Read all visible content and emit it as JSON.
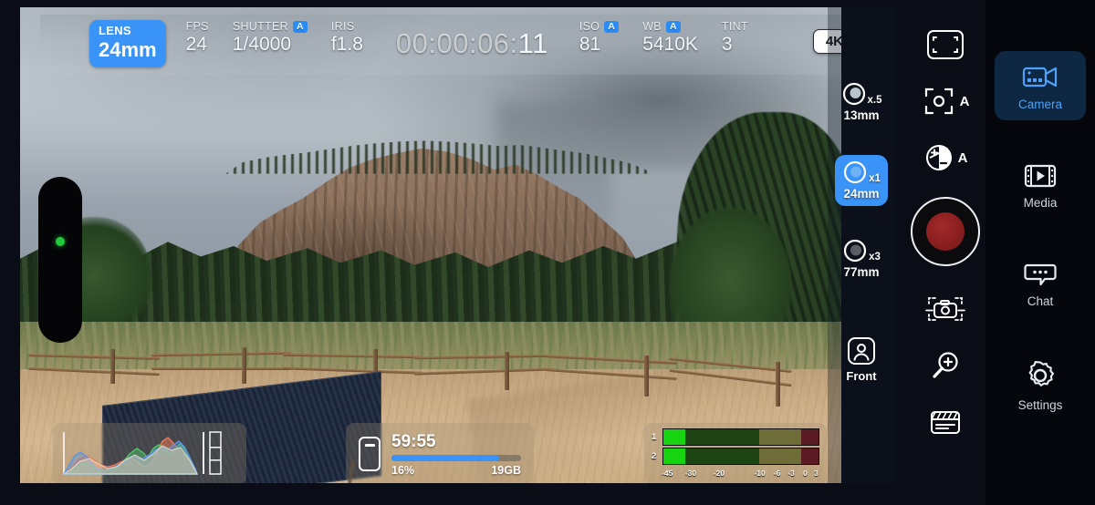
{
  "app": {
    "accent_blue": "#3a93f7",
    "record_red": "#8a1f1f",
    "panel_dark": "#06070c"
  },
  "topbar": {
    "lens": {
      "label": "LENS",
      "value": "24mm",
      "selected": true
    },
    "fps": {
      "label": "FPS",
      "value": "24"
    },
    "shutter": {
      "label": "SHUTTER",
      "value": "1/4000",
      "auto_badge": "A"
    },
    "iris": {
      "label": "IRIS",
      "value": "f1.8"
    },
    "timecode": {
      "dim": "00:00:06:",
      "bright": "11",
      "full": "00:00:06:11"
    },
    "iso": {
      "label": "ISO",
      "value": "81",
      "auto_badge": "A"
    },
    "wb": {
      "label": "WB",
      "value": "5410K",
      "auto_badge": "A"
    },
    "tint": {
      "label": "TINT",
      "value": "3"
    },
    "resolution_badge": "4K"
  },
  "focus_indicator": {
    "name": "focus-status-pill",
    "dot_color": "#22c93a"
  },
  "lens_selector": {
    "options": [
      {
        "zoom": "x.5",
        "focal": "13mm",
        "selected": false
      },
      {
        "zoom": "x1",
        "focal": "24mm",
        "selected": true
      },
      {
        "zoom": "x3",
        "focal": "77mm",
        "selected": false
      }
    ],
    "front_camera": {
      "label": "Front",
      "icon": "person-icon"
    }
  },
  "histogram": {
    "title": "rgb-histogram",
    "channels": [
      "red",
      "green",
      "blue",
      "luma"
    ]
  },
  "storage": {
    "icon": "battery-icon",
    "time_remaining": "59:55",
    "percent": "16%",
    "free_space": "19GB",
    "bar_fill_percent": 83
  },
  "audio_meters": {
    "channels": [
      {
        "name": "1",
        "level_percent": 14
      },
      {
        "name": "2",
        "level_percent": 14
      }
    ],
    "scale_ticks": [
      "-45",
      "-30",
      "-20",
      "-10",
      "-6",
      "-3",
      "0",
      "3"
    ],
    "tick_positions": [
      2,
      18,
      36,
      62,
      73,
      82,
      91,
      98
    ]
  },
  "icon_bar": {
    "items": [
      {
        "name": "framing-guides-icon",
        "aux": ""
      },
      {
        "name": "autofocus-icon",
        "aux": "A"
      },
      {
        "name": "exposure-compensation-icon",
        "aux": "A"
      },
      {
        "name": "record-button",
        "aux": ""
      },
      {
        "name": "snapshot-icon",
        "aux": ""
      },
      {
        "name": "zoom-magnifier-icon",
        "aux": ""
      },
      {
        "name": "clapperboard-icon",
        "aux": ""
      }
    ]
  },
  "nav": {
    "items": [
      {
        "label": "Camera",
        "icon": "video-camera-icon",
        "selected": true
      },
      {
        "label": "Media",
        "icon": "film-play-icon",
        "selected": false
      },
      {
        "label": "Chat",
        "icon": "chat-bubble-icon",
        "selected": false
      },
      {
        "label": "Settings",
        "icon": "gear-icon",
        "selected": false
      }
    ]
  }
}
